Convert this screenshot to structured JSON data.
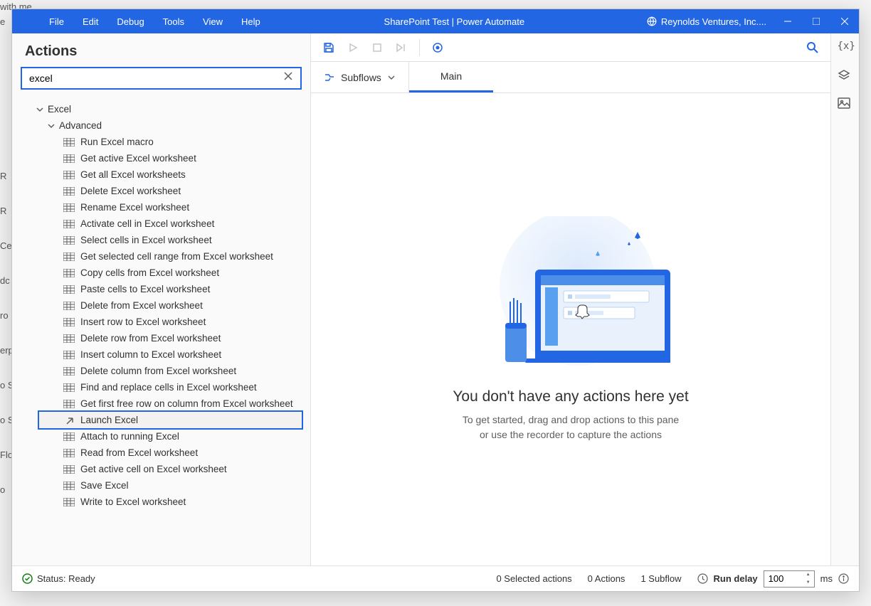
{
  "fragments": [
    "with me",
    "e",
    "R",
    "R",
    "Ce",
    "dc",
    "ro",
    "erp",
    "o S",
    "o S",
    "Flo",
    "o"
  ],
  "titlebar": {
    "menu": [
      "File",
      "Edit",
      "Debug",
      "Tools",
      "View",
      "Help"
    ],
    "title": "SharePoint Test | Power Automate",
    "org": "Reynolds Ventures, Inc...."
  },
  "sidebar": {
    "heading": "Actions",
    "search_value": "excel",
    "group": "Excel",
    "subgroup": "Advanced",
    "items": [
      {
        "label": "Run Excel macro"
      },
      {
        "label": "Get active Excel worksheet"
      },
      {
        "label": "Get all Excel worksheets"
      },
      {
        "label": "Delete Excel worksheet"
      },
      {
        "label": "Rename Excel worksheet"
      },
      {
        "label": "Activate cell in Excel worksheet"
      },
      {
        "label": "Select cells in Excel worksheet"
      },
      {
        "label": "Get selected cell range from Excel worksheet"
      },
      {
        "label": "Copy cells from Excel worksheet"
      },
      {
        "label": "Paste cells to Excel worksheet"
      },
      {
        "label": "Delete from Excel worksheet"
      },
      {
        "label": "Insert row to Excel worksheet"
      },
      {
        "label": "Delete row from Excel worksheet"
      },
      {
        "label": "Insert column to Excel worksheet"
      },
      {
        "label": "Delete column from Excel worksheet"
      },
      {
        "label": "Find and replace cells in Excel worksheet"
      },
      {
        "label": "Get first free row on column from Excel worksheet"
      },
      {
        "label": "Launch Excel",
        "highlight": true,
        "launch": true
      },
      {
        "label": "Attach to running Excel"
      },
      {
        "label": "Read from Excel worksheet"
      },
      {
        "label": "Get active cell on Excel worksheet"
      },
      {
        "label": "Save Excel"
      },
      {
        "label": "Write to Excel worksheet"
      }
    ]
  },
  "tabs": {
    "subflows_label": "Subflows",
    "main_tab": "Main"
  },
  "empty": {
    "title": "You don't have any actions here yet",
    "line1": "To get started, drag and drop actions to this pane",
    "line2": "or use the recorder to capture the actions"
  },
  "status": {
    "ready": "Status: Ready",
    "selected": "0 Selected actions",
    "actions": "0 Actions",
    "subflows": "1 Subflow",
    "run_delay_label": "Run delay",
    "run_delay_value": "100",
    "ms": "ms"
  }
}
